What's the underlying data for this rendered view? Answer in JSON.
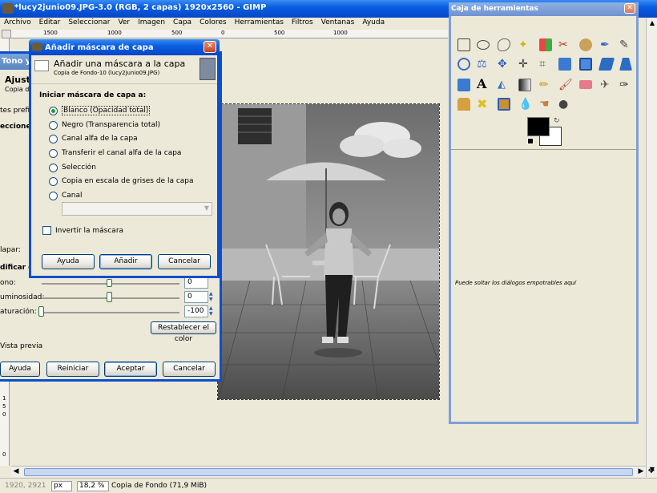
{
  "gimp_window": {
    "title": "*lucy2junio09.JPG-3.0 (RGB, 2 capas) 1920x2560 - GIMP",
    "menus": [
      "Archivo",
      "Editar",
      "Seleccionar",
      "Ver",
      "Imagen",
      "Capa",
      "Colores",
      "Herramientas",
      "Filtros",
      "Ventanas",
      "Ayuda"
    ],
    "ruler_marks": [
      "1500",
      "1000",
      "500",
      "0",
      "500",
      "1000"
    ],
    "vruler_marks": [
      "1",
      "5",
      "0",
      "0"
    ],
    "status": {
      "coords": "1920, 2921",
      "unit": "px",
      "zoom": "18,2 %",
      "layer_info": "Copia de Fondo (71,9 MiB)"
    }
  },
  "hue_dialog": {
    "title": "Tono y s",
    "header_title": "Ajusta",
    "header_sub": "Copia de",
    "presets_label": "tes prefij",
    "select_label": "eccione c",
    "overlap_label": "lapar:",
    "modify_label": "dificar el",
    "hue_label": "ono:",
    "hue_value": "0",
    "lightness_label": "uminosidad:",
    "lightness_value": "0",
    "saturation_label": "aturación:",
    "saturation_value": "-100",
    "saturation_level": 0,
    "reset_color_btn": "Restablecer el color",
    "preview_label": "Vista previa",
    "buttons": {
      "help": "Ayuda",
      "reset": "Reiniciar",
      "accept": "Aceptar",
      "cancel": "Cancelar"
    }
  },
  "mask_dialog": {
    "title": "Añadir máscara de capa",
    "header_title": "Añadir una máscara a la capa",
    "header_sub": "Copia de Fondo-10 (lucy2junio09.JPG)",
    "section_label": "Iniciar máscara de capa a:",
    "options": [
      {
        "label": "Blanco (Opacidad total)",
        "selected": true
      },
      {
        "label": "Negro (Transparencia total)",
        "selected": false
      },
      {
        "label": "Canal alfa de la capa",
        "selected": false
      },
      {
        "label": "Transferir el canal alfa de la capa",
        "selected": false
      },
      {
        "label": "Selección",
        "selected": false
      },
      {
        "label": "Copia en escala de grises de la capa",
        "selected": false
      },
      {
        "label": "Canal",
        "selected": false
      }
    ],
    "invert_label": "Invertir la máscara",
    "invert_checked": false,
    "buttons": {
      "help": "Ayuda",
      "add": "Añadir",
      "cancel": "Cancelar"
    }
  },
  "toolbox": {
    "title": "Caja de herramientas",
    "drop_hint": "Puede soltar los diálogos empotrables aquí",
    "fg_color": "#000000",
    "bg_color": "#ffffff"
  }
}
